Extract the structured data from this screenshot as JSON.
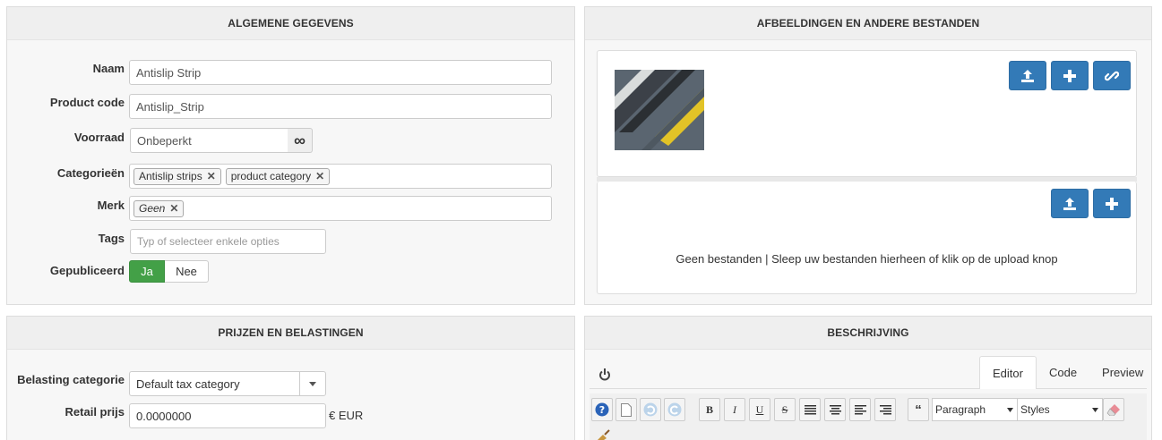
{
  "general": {
    "title": "ALGEMENE GEGEVENS",
    "name_label": "Naam",
    "name_value": "Antislip Strip",
    "code_label": "Product code",
    "code_value": "Antislip_Strip",
    "stock_label": "Voorraad",
    "stock_value": "Onbeperkt",
    "stock_infinite_symbol": "∞",
    "categories_label": "Categorieën",
    "categories": [
      "Antislip strips",
      "product category"
    ],
    "brand_label": "Merk",
    "brand_value": "Geen",
    "tags_label": "Tags",
    "tags_placeholder": "Typ of selecteer enkele opties",
    "published_label": "Gepubliceerd",
    "published_yes": "Ja",
    "published_no": "Nee"
  },
  "files": {
    "title": "AFBEELDINGEN EN ANDERE BESTANDEN",
    "empty_text": "Geen bestanden | Sleep uw bestanden hierheen of klik op de upload knop"
  },
  "pricing": {
    "title": "PRIJZEN EN BELASTINGEN",
    "tax_label": "Belasting categorie",
    "tax_value": "Default tax category",
    "price_label": "Retail prijs",
    "price_value": "0.0000000",
    "currency": "€ EUR"
  },
  "description": {
    "title": "BESCHRIJVING",
    "tabs": [
      "Editor",
      "Code",
      "Preview"
    ],
    "format_value": "Paragraph",
    "styles_value": "Styles",
    "toolbar": {
      "bold": "B",
      "italic": "I",
      "underline": "U",
      "strike": "S",
      "quote": "“"
    }
  },
  "colors": {
    "primary": "#337ab7",
    "success": "#43a047"
  }
}
